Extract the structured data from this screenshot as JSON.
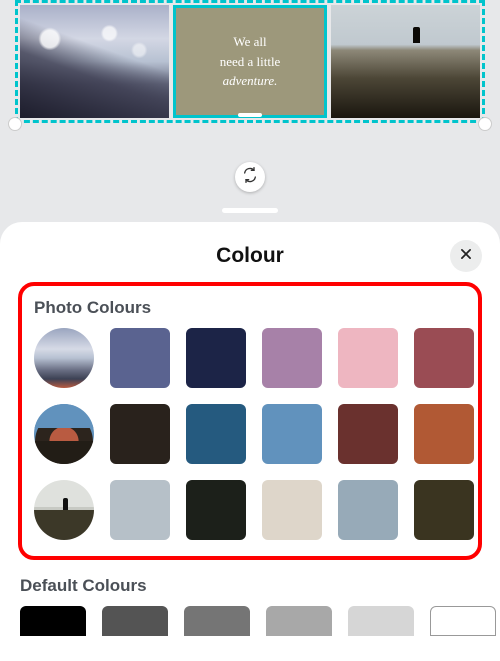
{
  "canvas": {
    "quote_line1": "We all",
    "quote_line2": "need a little",
    "quote_line3": "adventure.",
    "swap_icon": "swap-icon"
  },
  "sheet": {
    "title": "Colour",
    "close_icon": "close-icon",
    "photo_section_title": "Photo Colours",
    "default_section_title": "Default Colours",
    "photo_rows": [
      {
        "thumb": "mountain-photo",
        "swatches": [
          "#5a6390",
          "#1c2447",
          "#a781a8",
          "#eeb6c1",
          "#9a4c54"
        ]
      },
      {
        "thumb": "sunset-photo",
        "swatches": [
          "#29221c",
          "#255a7f",
          "#6192bd",
          "#6a312e",
          "#b15934"
        ]
      },
      {
        "thumb": "hiker-photo",
        "swatches": [
          "#b6c0c8",
          "#1c201a",
          "#ded6ca",
          "#97aab8",
          "#3a3420"
        ]
      }
    ],
    "default_swatches": [
      "#000000",
      "#545454",
      "#757575",
      "#a8a8a8",
      "#d6d6d6",
      "#ffffff"
    ]
  }
}
